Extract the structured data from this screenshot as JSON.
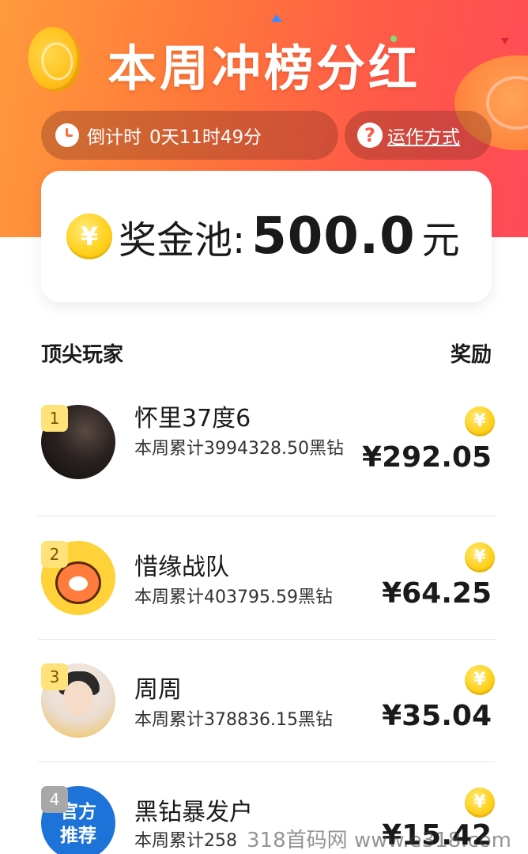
{
  "hero": {
    "title": "本周冲榜分红",
    "countdown_label": "倒计时",
    "countdown_value": "0天11时49分",
    "howto_link": "运作方式",
    "help_glyph": "?"
  },
  "pool": {
    "label": "奖金池:",
    "amount": "500.0",
    "unit": "元",
    "coin_glyph": "¥"
  },
  "list": {
    "header_left": "顶尖玩家",
    "header_right": "奖励",
    "players": [
      {
        "rank": "1",
        "name": "怀里37度6",
        "stat": "本周累计3994328.50黑钻",
        "reward": "¥292.05"
      },
      {
        "rank": "2",
        "name": "惜缘战队",
        "stat": "本周累计403795.59黑钻",
        "reward": "¥64.25"
      },
      {
        "rank": "3",
        "name": "周周",
        "stat": "本周累计378836.15黑钻",
        "reward": "¥35.04"
      },
      {
        "rank": "4",
        "name": "黑钻暴发户",
        "stat": "本周累计258",
        "reward": "¥15.42",
        "avatar_text_1": "官方",
        "avatar_text_2": "推荐"
      }
    ]
  },
  "watermark": "318首码网 www.e318.com",
  "colors": {
    "hero_gradient_start": "#ff9a3c",
    "hero_gradient_end": "#ff4a58",
    "coin_gold": "#ffd21e",
    "badge_gold": "#ffe27a",
    "official_blue": "#1e73d8"
  },
  "icons": {
    "countdown": "clock-icon",
    "howto": "help-icon",
    "pool": "gold-coin-icon",
    "reward": "gold-coin-icon"
  }
}
